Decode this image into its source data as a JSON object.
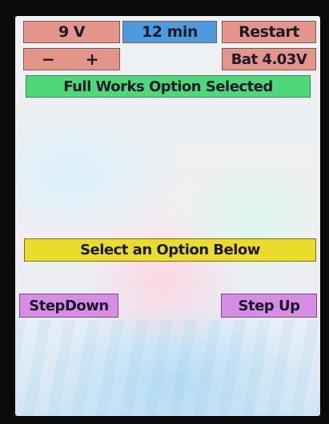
{
  "top_row": {
    "voltage": "9 V",
    "timer": "12 min",
    "restart_label": "Restart"
  },
  "second_row": {
    "decrement_label": "−",
    "increment_label": "+",
    "battery": "Bat 4.03V"
  },
  "status_banner": "Full Works Option Selected",
  "prompt_banner": "Select an Option Below",
  "step_down_label": "StepDown",
  "step_up_label": "Step Up",
  "colors": {
    "salmon": "#e4958a",
    "blue": "#4c9bdc",
    "green": "#4fd87a",
    "yellow": "#e9dc2d",
    "violet": "#d58ee4"
  }
}
